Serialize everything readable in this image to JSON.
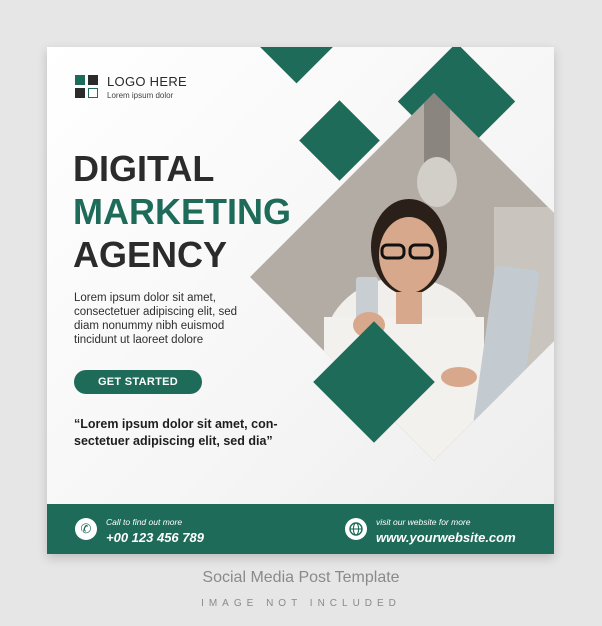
{
  "colors": {
    "accent": "#1f6b5a",
    "dark": "#2b2b2b"
  },
  "logo": {
    "title": "LOGO HERE",
    "subtitle": "Lorem ipsum dolor"
  },
  "headline": {
    "line1": "DIGITAL",
    "line2": "MARKETING",
    "line3": "AGENCY"
  },
  "body_text": "Lorem ipsum dolor sit amet, consectetuer adipiscing elit, sed diam nonummy nibh euismod tincidunt ut laoreet dolore",
  "cta_label": "GET STARTED",
  "quote": "“Lorem ipsum dolor sit amet, con-sectetuer adipiscing elit, sed dia”",
  "footer": {
    "phone_caption": "Call to find out more",
    "phone": "+00 123 456 789",
    "web_caption": "visit our website for more",
    "website": "www.yourwebsite.com"
  },
  "caption": {
    "title": "Social Media Post Template",
    "note": "IMAGE NOT INCLUDED"
  },
  "icons": {
    "phone": "phone-icon",
    "globe": "globe-icon"
  }
}
